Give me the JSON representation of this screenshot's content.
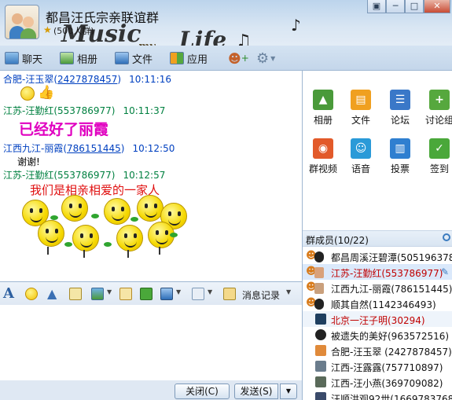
{
  "window": {
    "group_name": "都昌汪氏宗亲联谊群",
    "group_size": "(500人群)",
    "watermark_1": "Music",
    "watermark_2": "Life",
    "watermark_3": "my",
    "btn_min": "─",
    "btn_max": "□",
    "btn_close": "✕",
    "btn_skin": "▣"
  },
  "toolbar": {
    "items": [
      {
        "label": "聊天",
        "icon": "chat-icon"
      },
      {
        "label": "相册",
        "icon": "album-icon"
      },
      {
        "label": "文件",
        "icon": "folder-icon"
      },
      {
        "label": "应用",
        "icon": "apps-icon"
      }
    ],
    "add_friend_icon": "add-member-icon",
    "settings_icon": "gear-icon"
  },
  "chat": {
    "messages": [
      {
        "name": "合肥-汪玉翠",
        "qq": "2427878457",
        "time": "10:11:16",
        "text": ""
      },
      {
        "name": "江苏-汪勤红",
        "qq": "553786977",
        "time": "10:11:37",
        "text": "已经好了丽霞"
      },
      {
        "name": "江西九江-丽霞",
        "qq": "786151445",
        "time": "10:12:50",
        "text": "谢谢!"
      },
      {
        "name": "江苏-汪勤红",
        "qq": "553786977",
        "time": "10:12:57",
        "text": "我们是相亲相爱的一家人"
      }
    ]
  },
  "format_bar": {
    "history_label": "消息记录"
  },
  "bottom": {
    "close_label": "关闭(C)",
    "send_label": "发送(S)"
  },
  "apps": [
    {
      "label": "相册",
      "color": "#4a9a3a",
      "glyph": "▲"
    },
    {
      "label": "文件",
      "color": "#f0a020",
      "glyph": "▤"
    },
    {
      "label": "论坛",
      "color": "#3a78c8",
      "glyph": "☰"
    },
    {
      "label": "讨论组",
      "color": "#56a83e",
      "glyph": "+"
    },
    {
      "label": "群视频",
      "color": "#e25a2a",
      "glyph": "◉"
    },
    {
      "label": "语音",
      "color": "#2a9ad8",
      "glyph": "☺"
    },
    {
      "label": "投票",
      "color": "#2f7fd0",
      "glyph": "▥"
    },
    {
      "label": "签到",
      "color": "#4aa83a",
      "glyph": "✓"
    }
  ],
  "members": {
    "title": "群成员(10/22)",
    "list": [
      {
        "name": "都昌周溪汪碧潭(505196378)",
        "color": "#111111"
      },
      {
        "name": "江苏-汪勤红(553786977)",
        "color": "#c00000"
      },
      {
        "name": "江西九江-丽霞(786151445)",
        "color": "#111111"
      },
      {
        "name": "顺其自然(1142346493)",
        "color": "#111111"
      },
      {
        "name": "北京一汪子明(30294)",
        "color": "#c00000"
      },
      {
        "name": "被遗失的美好(963572516)",
        "color": "#111111"
      },
      {
        "name": "合肥-汪玉翠 (2427878457)",
        "color": "#111111"
      },
      {
        "name": "江西-汪露露(757710897)",
        "color": "#111111"
      },
      {
        "name": "江西-汪小燕(369709082)",
        "color": "#111111"
      },
      {
        "name": "汪顺洪观92世(1669783768)",
        "color": "#111111"
      }
    ]
  }
}
